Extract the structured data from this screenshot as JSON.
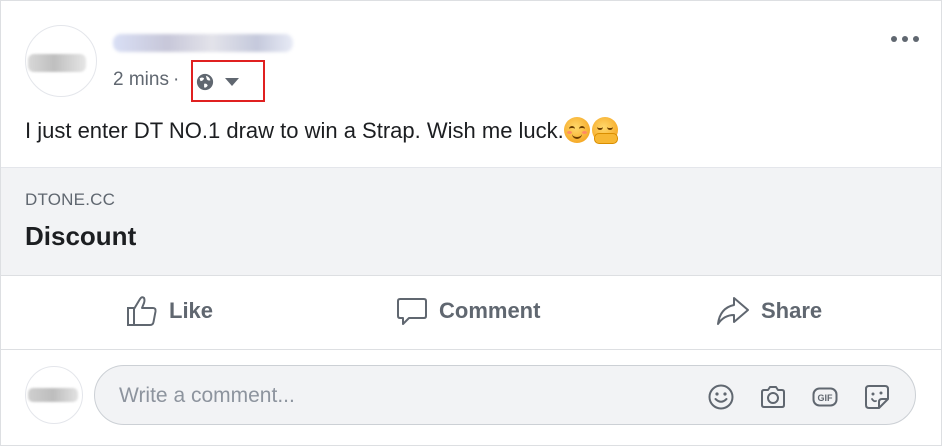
{
  "post": {
    "time": "2 mins",
    "separator": "·",
    "audience_icon": "globe-icon",
    "text": "I just enter DT NO.1 draw to win a Strap. Wish me luck.",
    "emojis": [
      "smiling-face-emoji",
      "hugging-face-emoji"
    ]
  },
  "link_preview": {
    "domain": "DTONE.CC",
    "title": "Discount"
  },
  "actions": {
    "like": "Like",
    "comment": "Comment",
    "share": "Share"
  },
  "comment_box": {
    "placeholder": "Write a comment...",
    "icons": [
      "emoji-icon",
      "camera-icon",
      "gif-icon",
      "sticker-icon"
    ]
  },
  "colors": {
    "highlight_box": "#e02020",
    "muted_text": "#606770",
    "preview_bg": "#f2f3f5"
  }
}
